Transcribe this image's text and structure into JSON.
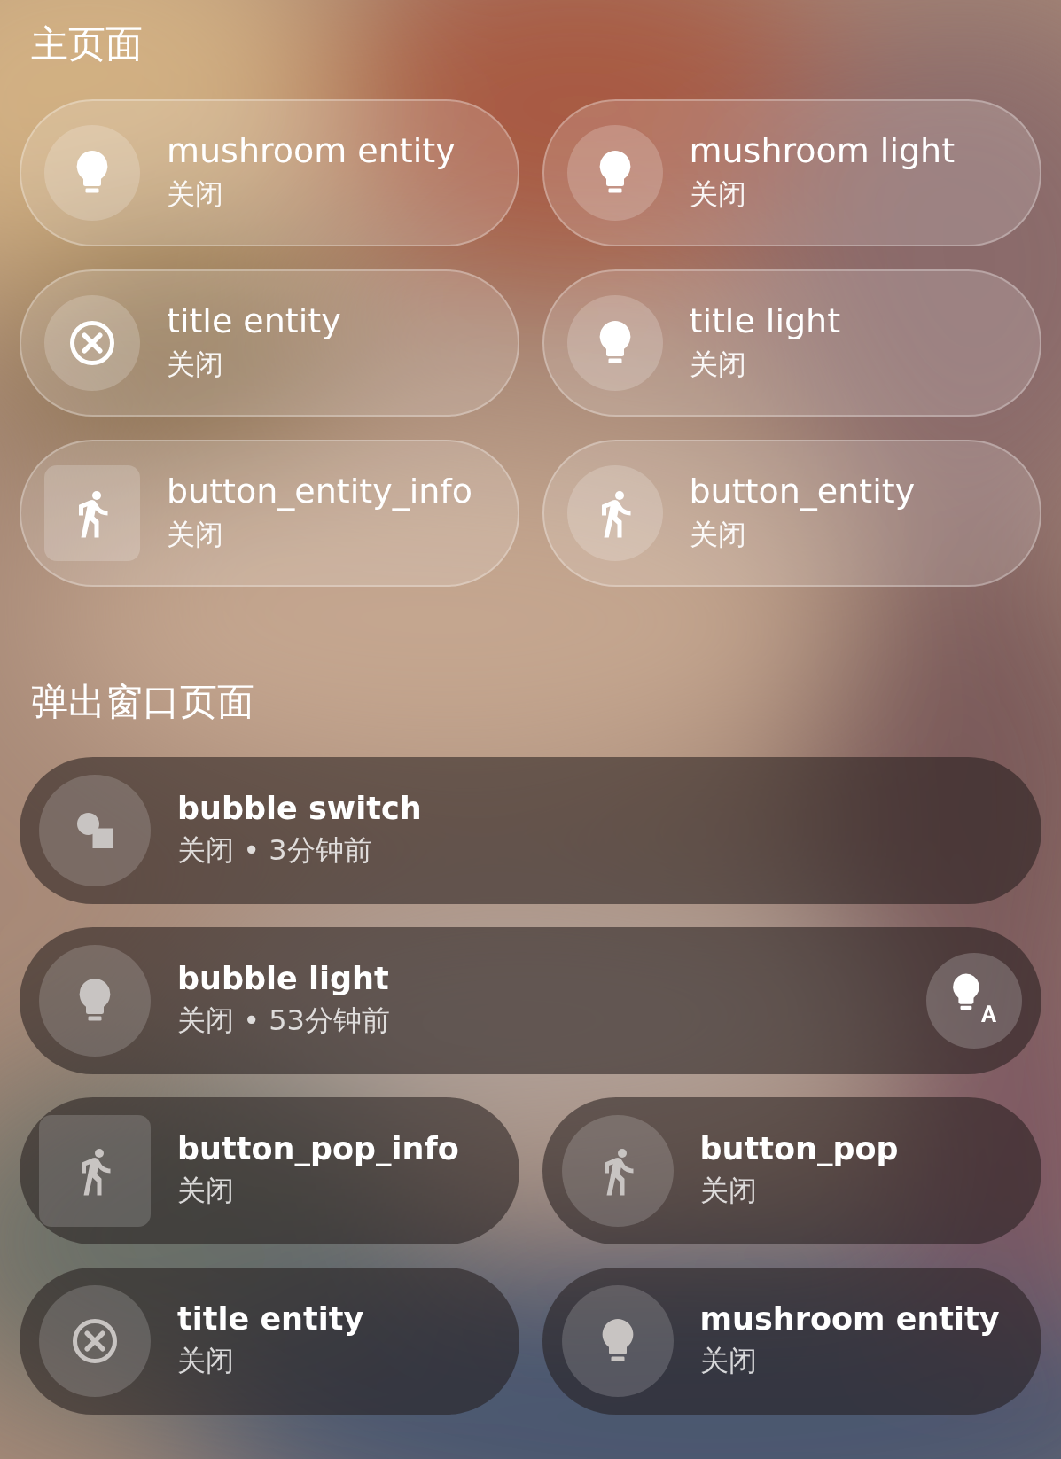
{
  "sections": [
    {
      "title": "主页面",
      "kind": "light",
      "cards": [
        {
          "name": "mushroom entity",
          "state": "关闭",
          "kind": "bulb",
          "wide": false
        },
        {
          "name": "mushroom light",
          "state": "关闭",
          "kind": "bulb",
          "wide": false
        },
        {
          "name": "title entity",
          "state": "关闭",
          "kind": "cross",
          "wide": false
        },
        {
          "name": "title light",
          "state": "关闭",
          "kind": "bulb",
          "wide": false
        },
        {
          "name": "button_entity_info",
          "state": "关闭",
          "kind": "runner-tile",
          "wide": false
        },
        {
          "name": "button_entity",
          "state": "关闭",
          "kind": "runner",
          "wide": false
        }
      ]
    },
    {
      "title": "弹出窗口页面",
      "kind": "dark",
      "cards": [
        {
          "name": "bubble switch",
          "state": "关闭 • 3分钟前",
          "kind": "shapes",
          "wide": true
        },
        {
          "name": "bubble light",
          "state": "关闭 • 53分钟前",
          "kind": "bulb",
          "wide": true,
          "button": {
            "kind": "bulb-auto"
          }
        },
        {
          "name": "button_pop_info",
          "state": "关闭",
          "kind": "runner-tile",
          "wide": false
        },
        {
          "name": "button_pop",
          "state": "关闭",
          "kind": "runner",
          "wide": false
        },
        {
          "name": "title entity",
          "state": "关闭",
          "kind": "cross",
          "wide": false
        },
        {
          "name": "mushroom entity",
          "state": "关闭",
          "kind": "bulb",
          "wide": false
        }
      ]
    }
  ]
}
